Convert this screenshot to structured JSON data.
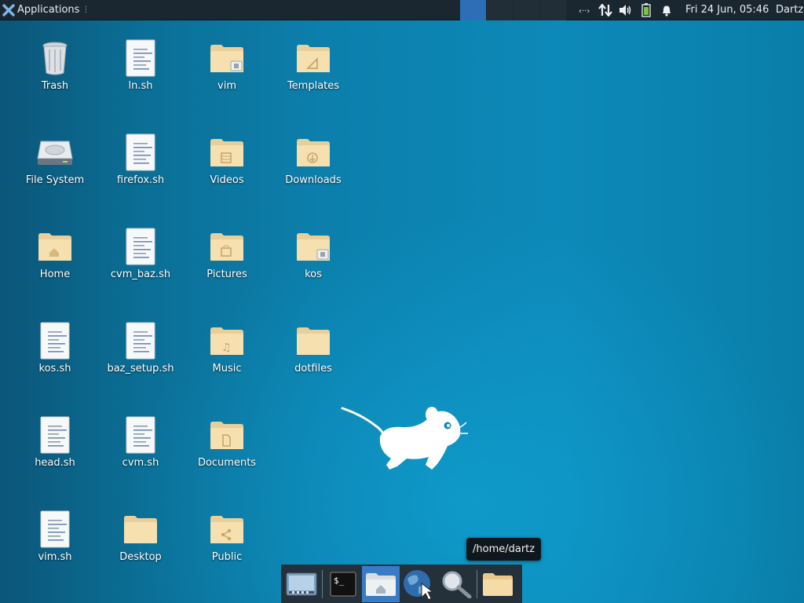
{
  "panel": {
    "applications_label": "Applications",
    "menu_indicator": "⋮",
    "workspaces": [
      {
        "active": true
      },
      {
        "active": false
      },
      {
        "active": false
      },
      {
        "active": false
      }
    ],
    "tray_icons": [
      "network-icon",
      "transfer-arrows-icon",
      "volume-icon",
      "battery-icon",
      "notification-bell-icon"
    ],
    "clock": "Fri 24 Jun, 05:46",
    "user": "Dartz"
  },
  "desktop": {
    "icons": [
      {
        "label": "Trash",
        "type": "trash"
      },
      {
        "label": "File System",
        "type": "drive"
      },
      {
        "label": "Home",
        "type": "folder-home"
      },
      {
        "label": "kos.sh",
        "type": "script"
      },
      {
        "label": "head.sh",
        "type": "script"
      },
      {
        "label": "vim.sh",
        "type": "script"
      },
      {
        "label": "ln.sh",
        "type": "script"
      },
      {
        "label": "firefox.sh",
        "type": "script"
      },
      {
        "label": "cvm_baz.sh",
        "type": "script"
      },
      {
        "label": "baz_setup.sh",
        "type": "script"
      },
      {
        "label": "cvm.sh",
        "type": "script"
      },
      {
        "label": "Desktop",
        "type": "folder"
      },
      {
        "label": "vim",
        "type": "folder-locked"
      },
      {
        "label": "Videos",
        "type": "folder-videos"
      },
      {
        "label": "Pictures",
        "type": "folder-pictures"
      },
      {
        "label": "Music",
        "type": "folder-music"
      },
      {
        "label": "Documents",
        "type": "folder-documents"
      },
      {
        "label": "Public",
        "type": "folder-public"
      },
      {
        "label": "Templates",
        "type": "folder-templates"
      },
      {
        "label": "Downloads",
        "type": "folder-downloads"
      },
      {
        "label": "kos",
        "type": "folder-locked"
      },
      {
        "label": "dotfiles",
        "type": "folder"
      }
    ]
  },
  "tooltip": "/home/dartz",
  "dock": {
    "items": [
      {
        "name": "show-desktop-icon"
      },
      {
        "name": "terminal-icon"
      },
      {
        "name": "home-folder-icon",
        "active": true
      },
      {
        "name": "web-browser-icon"
      },
      {
        "name": "search-icon"
      },
      {
        "name": "folder-icon"
      }
    ]
  },
  "colors": {
    "panel_bg": "#1b2730",
    "active_workspace": "#2d6fb6",
    "folder": "#f3d9a0",
    "desktop_bg": "#0d89b8"
  }
}
